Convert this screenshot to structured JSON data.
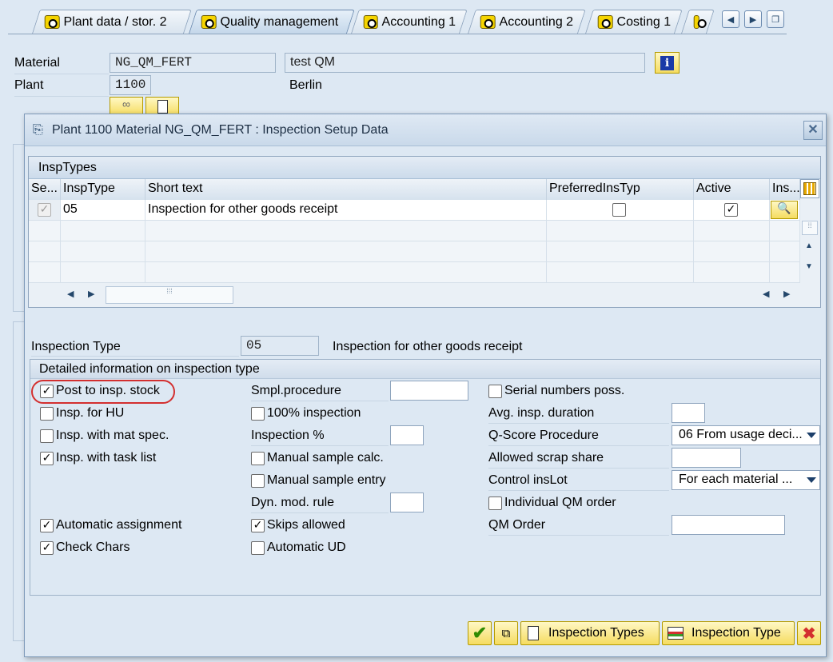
{
  "tabs": [
    "Plant data / stor. 2",
    "Quality management",
    "Accounting 1",
    "Accounting 2",
    "Costing 1"
  ],
  "header": {
    "material_label": "Material",
    "material_value": "NG_QM_FERT",
    "material_desc": "test QM",
    "plant_label": "Plant",
    "plant_value": "1100",
    "plant_desc": "Berlin"
  },
  "dialog": {
    "title": "Plant 1100 Material NG_QM_FERT : Inspection Setup Data",
    "table_title": "InspTypes",
    "columns": [
      "Se...",
      "InspType",
      "Short text",
      "PreferredInsTyp",
      "Active",
      "Ins..."
    ],
    "row": {
      "insp_type": "05",
      "short_text": "Inspection for other goods receipt",
      "preferred": false,
      "active": true,
      "selected": true
    },
    "insp_type_label": "Inspection Type",
    "insp_type_value": "05",
    "insp_type_desc": "Inspection for other goods receipt",
    "details_title": "Detailed information on inspection type",
    "col1": [
      {
        "label": "Post to insp. stock",
        "checked": true
      },
      {
        "label": "Insp. for HU",
        "checked": false
      },
      {
        "label": "Insp. with mat spec.",
        "checked": false
      },
      {
        "label": "Insp. with task list",
        "checked": true
      },
      {
        "label": "Automatic assignment",
        "checked": true
      },
      {
        "label": "Check Chars",
        "checked": true
      }
    ],
    "col2": {
      "smpl_procedure": "Smpl.procedure",
      "inspection_100": "100% inspection",
      "inspection_pct": "Inspection %",
      "manual_sample_calc": "Manual sample calc.",
      "manual_sample_entry": "Manual sample entry",
      "dyn_mod_rule": "Dyn. mod. rule",
      "skips_allowed": "Skips allowed",
      "automatic_ud": "Automatic UD"
    },
    "col3": {
      "serial_numbers": "Serial numbers poss.",
      "avg_duration": "Avg. insp. duration",
      "qscore": "Q-Score Procedure",
      "qscore_value": "06 From usage deci...",
      "scrap_share": "Allowed scrap share",
      "control_inslot": "Control insLot",
      "control_value": "For each material ...",
      "individual_qm": "Individual QM order",
      "qm_order": "QM Order"
    },
    "buttons": {
      "inspection_types": "Inspection Types",
      "inspection_type": "Inspection Type"
    }
  },
  "colors": {
    "accent": "#f5dc60",
    "circle": "#d32f2f"
  }
}
